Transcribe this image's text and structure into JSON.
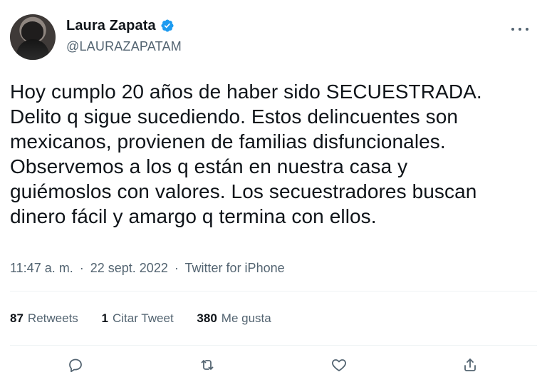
{
  "author": {
    "display_name": "Laura Zapata",
    "handle": "@LAURAZAPATAM",
    "verified_icon": "verified-badge-icon",
    "avatar_icon": "avatar"
  },
  "tweet": {
    "text": "Hoy cumplo 20 años de haber sido SECUESTRADA.\nDelito q sigue sucediendo. Estos delincuentes son\nmexicanos, provienen de familias disfuncionales.\nObservemos a los q están en nuestra casa y\nguiémoslos con valores. Los secuestradores buscan\ndinero fácil y amargo q termina con ellos.",
    "time": "11:47 a. m.",
    "date": "22 sept. 2022",
    "source": "Twitter for iPhone",
    "separator": "·"
  },
  "stats": {
    "retweets": {
      "count": "87",
      "label": "Retweets"
    },
    "quotes": {
      "count": "1",
      "label": "Citar Tweet"
    },
    "likes": {
      "count": "380",
      "label": "Me gusta"
    }
  },
  "actions": [
    {
      "name": "reply",
      "icon": "reply-icon"
    },
    {
      "name": "retweet",
      "icon": "retweet-icon"
    },
    {
      "name": "like",
      "icon": "heart-icon"
    },
    {
      "name": "share",
      "icon": "share-icon"
    }
  ],
  "colors": {
    "text_primary": "#0f1419",
    "text_secondary": "#536471",
    "divider": "#eff3f4",
    "verified_blue": "#1d9bf0",
    "icon_gray": "#536471"
  }
}
